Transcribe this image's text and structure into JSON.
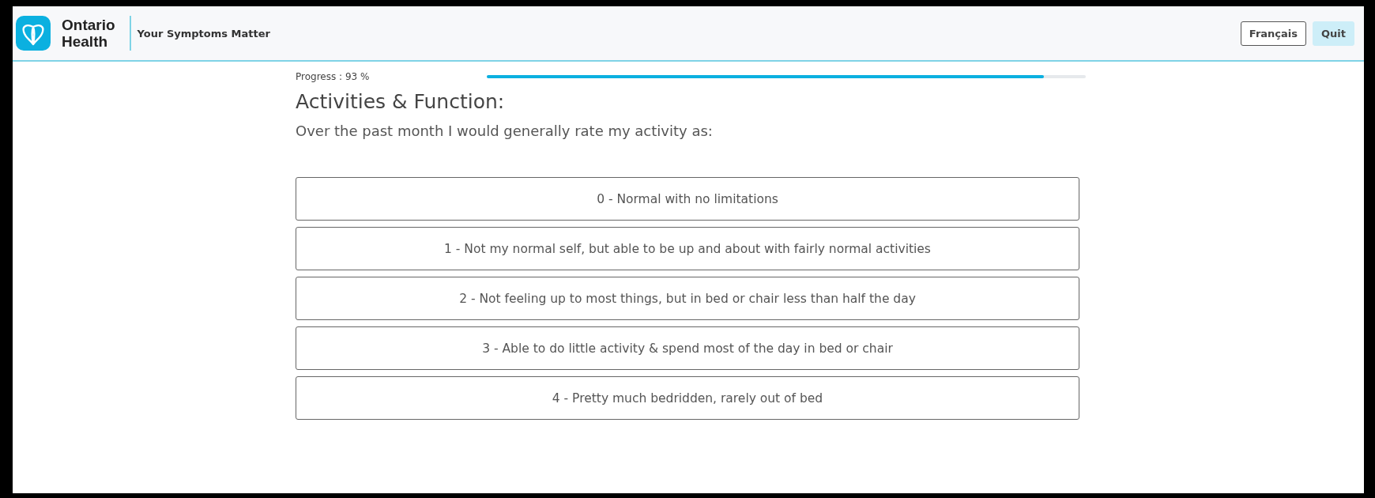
{
  "header": {
    "brand_line_1": "Ontario",
    "brand_line_2": "Health",
    "app_title": "Your Symptoms Matter",
    "buttons": [
      {
        "label": "Français",
        "kind": "outline"
      },
      {
        "label": "Quit",
        "kind": "filled"
      }
    ]
  },
  "progress": {
    "label": "Progress : 93 %",
    "level": 0.93
  },
  "section_title": "Activities & Function:",
  "question": "Over the past month I would generally rate my activity as:",
  "options": [
    {
      "label": "0 - Normal with no limitations",
      "selected": false
    },
    {
      "label": "1 - Not my normal self, but able to be up and about with fairly normal activities",
      "selected": false
    },
    {
      "label": "2 - Not feeling up to most things, but in bed or chair less than half the day",
      "selected": false
    },
    {
      "label": "3 - Able to do little activity & spend most of the day in bed or chair",
      "selected": false
    },
    {
      "label": "4 - Pretty much bedridden, rarely out of bed",
      "selected": false
    }
  ]
}
